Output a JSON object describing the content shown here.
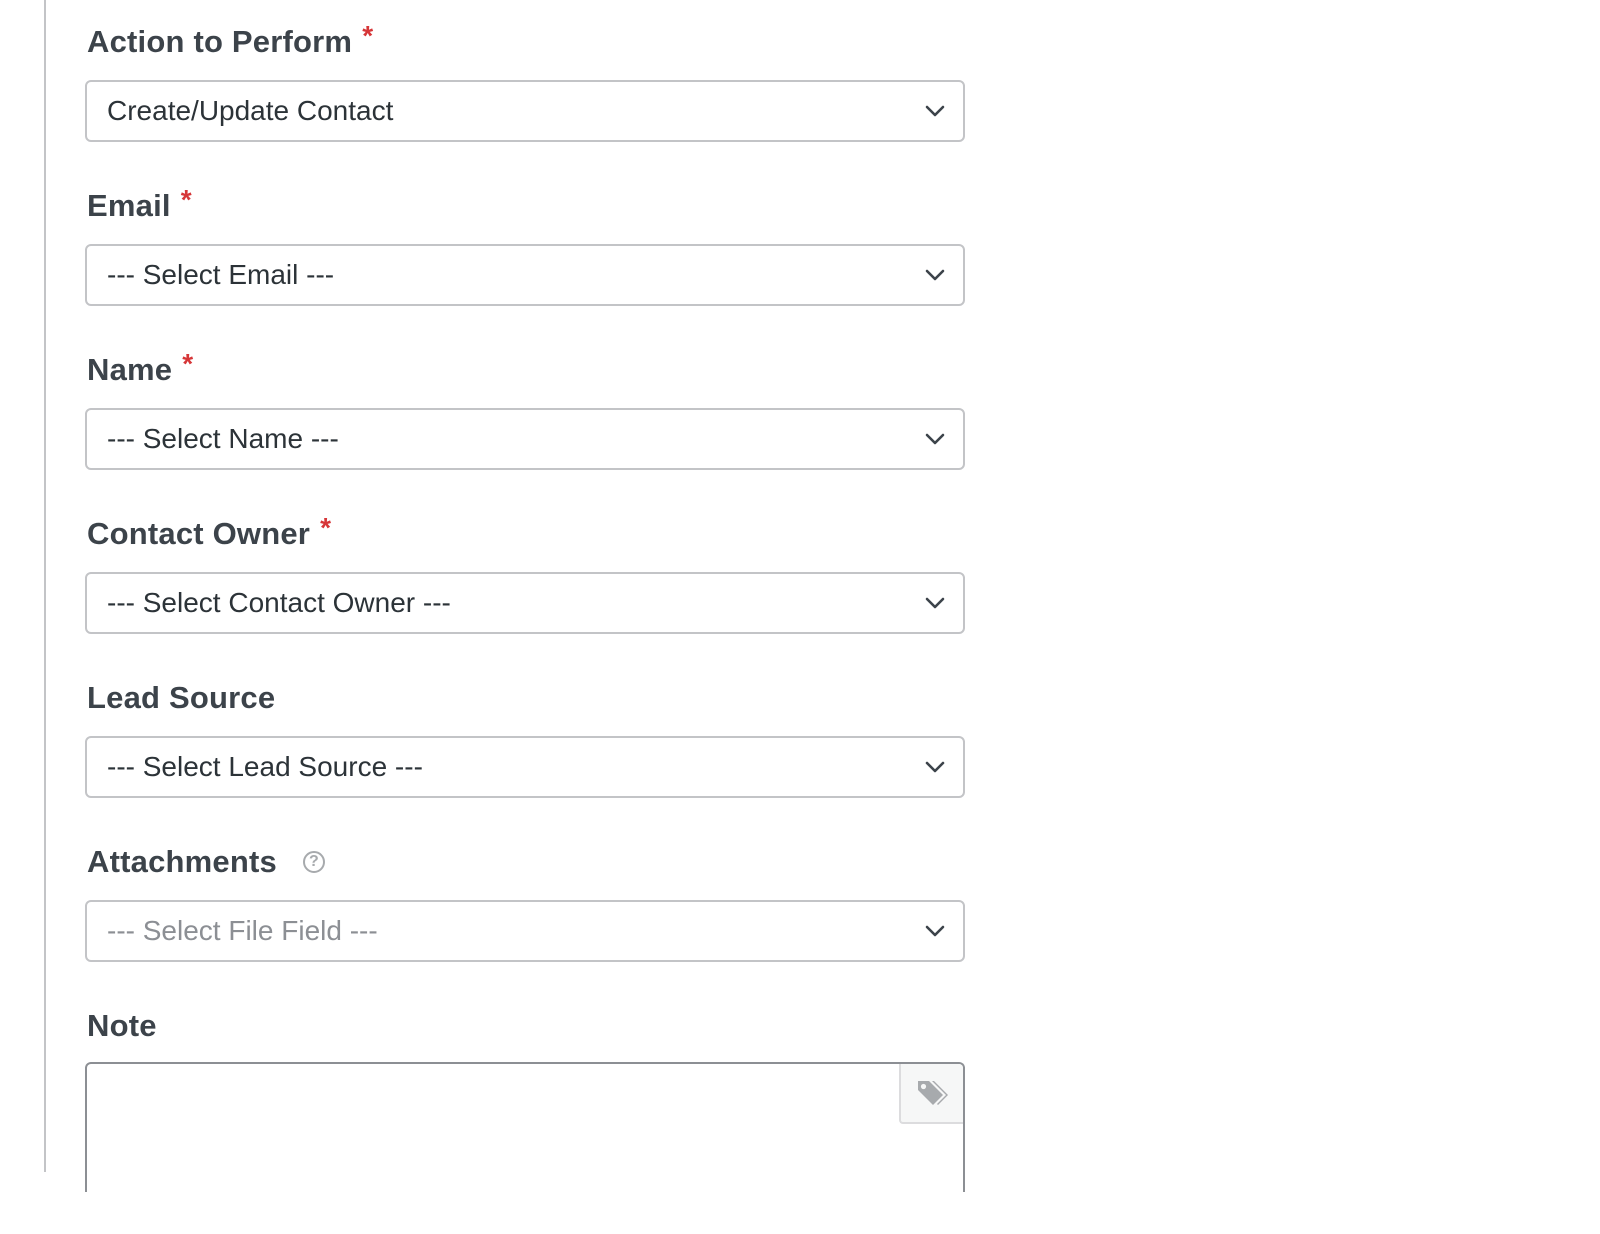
{
  "form": {
    "fields": [
      {
        "label": "Action to Perform",
        "required": true,
        "value": "Create/Update Contact"
      },
      {
        "label": "Email",
        "required": true,
        "value": "--- Select Email ---"
      },
      {
        "label": "Name",
        "required": true,
        "value": "--- Select Name ---"
      },
      {
        "label": "Contact Owner",
        "required": true,
        "value": "--- Select Contact Owner ---"
      },
      {
        "label": "Lead Source",
        "required": false,
        "value": "--- Select Lead Source ---"
      },
      {
        "label": "Attachments",
        "required": false,
        "value": "--- Select File Field ---"
      }
    ],
    "required_mark": "*",
    "help_mark": "?",
    "note": {
      "label": "Note",
      "value": ""
    }
  },
  "icons": {
    "chevron": "chevron-down-icon",
    "help": "question-circle-icon",
    "tag": "tags-icon"
  },
  "colors": {
    "required": "#d63638",
    "border": "#c3c4c7",
    "label": "#3c434a",
    "muted": "#8c8f94"
  }
}
